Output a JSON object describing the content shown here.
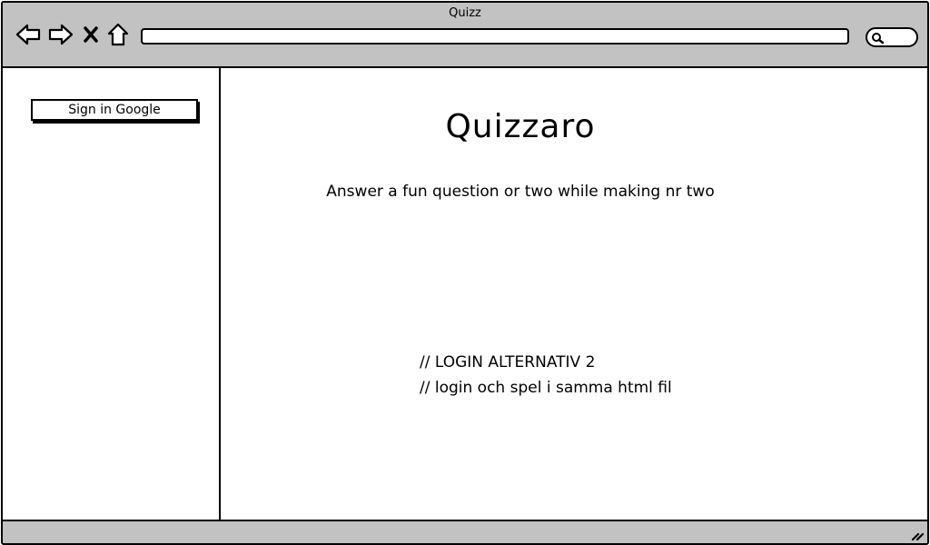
{
  "window": {
    "title": "Quizz"
  },
  "toolbar": {
    "icons": [
      "back-arrow-icon",
      "forward-arrow-icon",
      "close-icon",
      "home-icon",
      "search-icon"
    ],
    "address_value": ""
  },
  "sidebar": {
    "sign_in_label": "Sign in Google"
  },
  "main": {
    "title": "Quizzaro",
    "tagline": "Answer a fun question or two while making nr two",
    "comments": [
      "// LOGIN ALTERNATIV 2",
      "// login och spel i samma html fil"
    ]
  },
  "colors": {
    "chrome": "#c2c2c2",
    "background": "#ffffff",
    "stroke": "#000000"
  }
}
